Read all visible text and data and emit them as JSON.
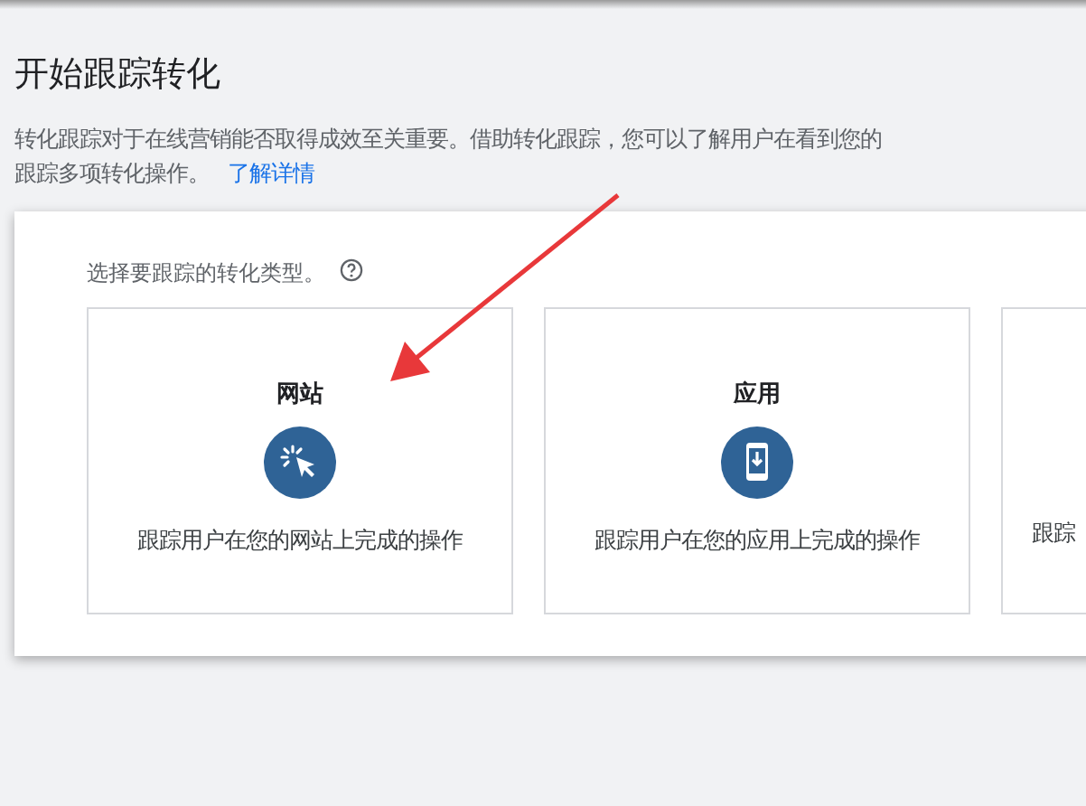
{
  "page": {
    "title": "开始跟踪转化",
    "intro_lines": [
      "转化跟踪对于在线营销能否取得成效至关重要。借助转化跟踪，您可以了解用户在看到您的",
      "跟踪多项转化操作。"
    ],
    "learn_more_link": "了解详情"
  },
  "panel": {
    "prompt": "选择要跟踪的转化类型。",
    "cards": [
      {
        "kind": "website",
        "title": "网站",
        "description": "跟踪用户在您的网站上完成的操作"
      },
      {
        "kind": "app",
        "title": "应用",
        "description": "跟踪用户在您的应用上完成的操作"
      },
      {
        "kind": "cut",
        "description": "跟踪"
      }
    ]
  }
}
